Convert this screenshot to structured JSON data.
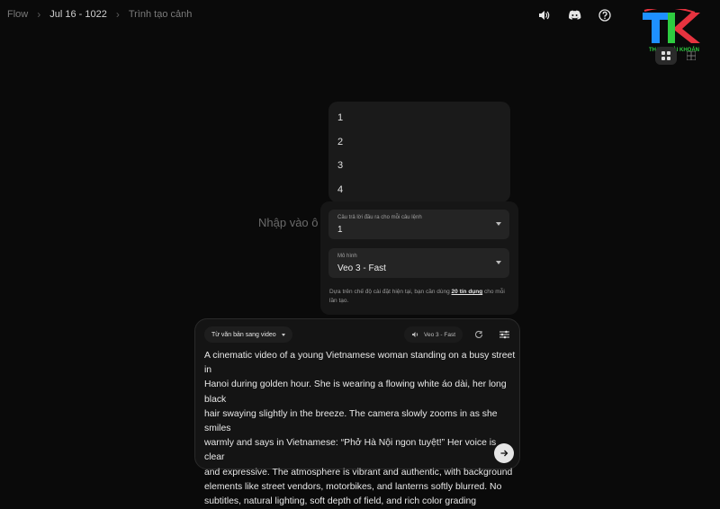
{
  "breadcrumb": {
    "root": "Flow",
    "project": "Jul 16 - 1022",
    "page": "Trình tạo cảnh"
  },
  "logo": {
    "text": "TK",
    "caption": "THANH TÀI KHOẢN",
    "colors": [
      "#1e90ff",
      "#2ecc40",
      "#e6333f"
    ]
  },
  "top_icons": [
    "volume-icon",
    "discord-icon",
    "help-icon"
  ],
  "view_toggle": {
    "active": "grid-view",
    "options": [
      "grid-view",
      "tile-view"
    ]
  },
  "dropdown_options": [
    "1",
    "2",
    "3",
    "4"
  ],
  "settings": {
    "outputs_label": "Câu trả lời đầu ra cho mỗi câu lệnh",
    "outputs_value": "1",
    "model_label": "Mô hình",
    "model_value": "Veo 3 - Fast",
    "note_before": "Dựa trên chế độ cài đặt hiện tại, bạn cần dùng ",
    "note_link": "20 tín dụng",
    "note_after": " cho mỗi lần tạo."
  },
  "ghost_label": "Nhập vào ô",
  "composer": {
    "mode": "Từ văn bản sang video",
    "model_chip": "Veo 3 - Fast",
    "prompt_lines": [
      "A cinematic video of a young Vietnamese woman standing on a busy street in",
      "Hanoi during golden hour. She is wearing a flowing white áo dài, her long black",
      "hair swaying slightly in the breeze. The camera slowly zooms in as she smiles",
      "warmly and says in Vietnamese: “Phở Hà Nội ngon tuyệt!” Her voice is clear",
      "and expressive. The atmosphere is vibrant and authentic, with background",
      "elements like street vendors, motorbikes, and lanterns softly blurred. No",
      "subtitles, natural lighting, soft depth of field, and rich color grading"
    ]
  }
}
